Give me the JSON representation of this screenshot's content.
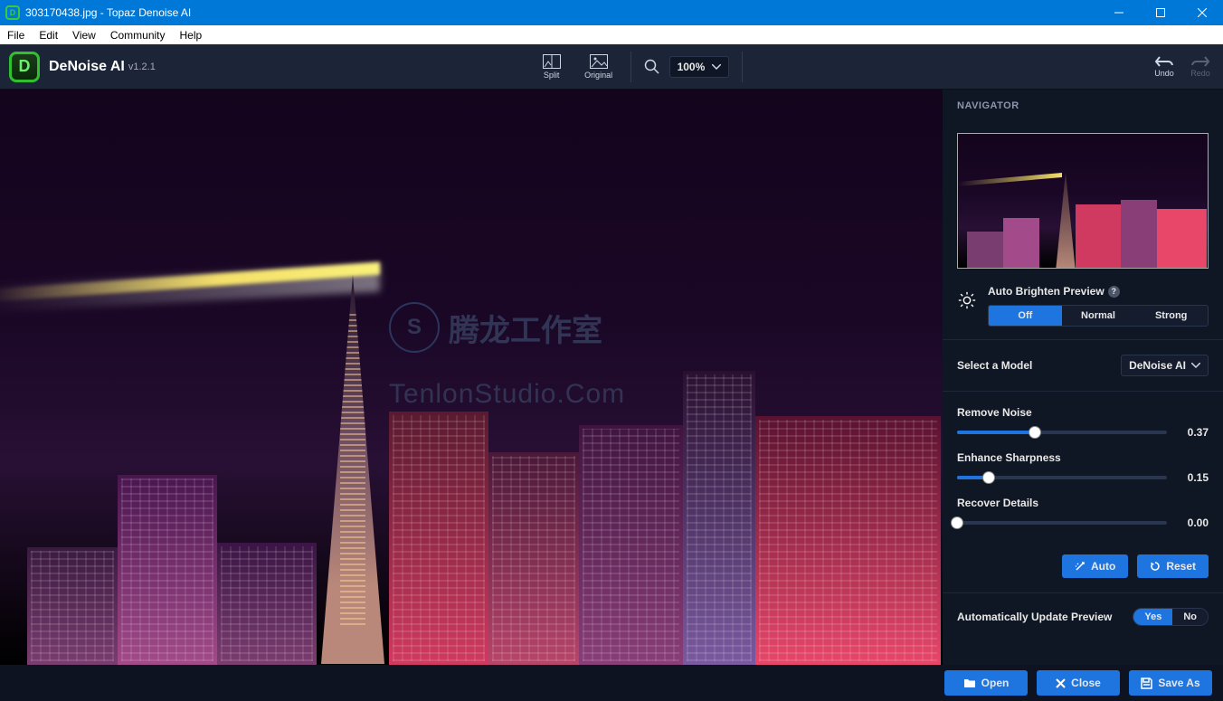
{
  "window": {
    "title": "303170438.jpg - Topaz Denoise AI"
  },
  "menu": [
    "File",
    "Edit",
    "View",
    "Community",
    "Help"
  ],
  "brand": {
    "name": "DeNoise AI",
    "version": "v1.2.1"
  },
  "toolbar": {
    "split": "Split",
    "original": "Original",
    "zoom": "100%",
    "undo": "Undo",
    "redo": "Redo"
  },
  "watermark": {
    "line1": "腾龙工作室",
    "line2": "TenlonStudio.Com"
  },
  "sidebar": {
    "nav_header": "NAVIGATOR",
    "brighten": {
      "label": "Auto Brighten Preview",
      "options": [
        "Off",
        "Normal",
        "Strong"
      ],
      "active": "Off"
    },
    "model": {
      "label": "Select a Model",
      "value": "DeNoise AI"
    },
    "sliders": {
      "remove_noise": {
        "label": "Remove Noise",
        "value": "0.37",
        "pct": 37
      },
      "enhance_sharpness": {
        "label": "Enhance Sharpness",
        "value": "0.15",
        "pct": 15
      },
      "recover_details": {
        "label": "Recover Details",
        "value": "0.00",
        "pct": 0
      }
    },
    "auto_btn": "Auto",
    "reset_btn": "Reset",
    "auto_update": {
      "label": "Automatically Update Preview",
      "options": [
        "Yes",
        "No"
      ],
      "active": "Yes"
    }
  },
  "footer": {
    "open": "Open",
    "close": "Close",
    "save_as": "Save As"
  }
}
